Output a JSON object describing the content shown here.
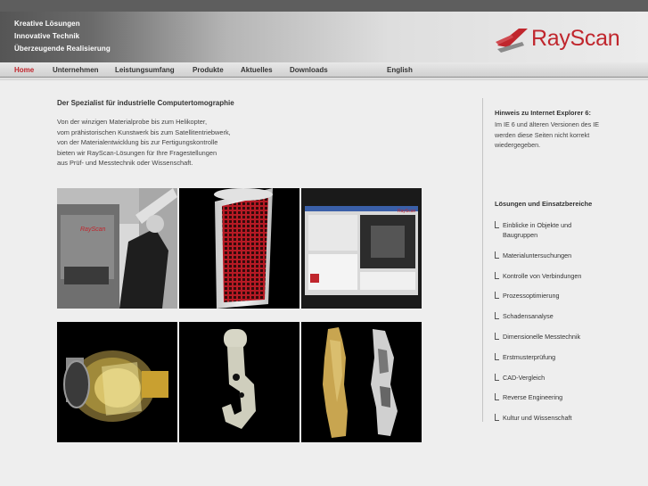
{
  "header": {
    "slogans": [
      "Kreative Lösungen",
      "Innovative Technik",
      "Überzeugende Realisierung"
    ],
    "logo_text": "RayScan",
    "brand_color": "#c0262d"
  },
  "nav": {
    "items": [
      "Home",
      "Unternehmen",
      "Leistungsumfang",
      "Produkte",
      "Aktuelles",
      "Downloads"
    ],
    "active": "Home",
    "language": "English"
  },
  "main": {
    "title": "Der Spezialist für industrielle Computertomographie",
    "intro_lines": [
      "Von der winzigen Materialprobe bis zum Helikopter,",
      "vom prähistorischen Kunstwerk bis zum Satellitentriebwerk,",
      "von der Materialentwicklung bis zur Fertigungskontrolle",
      "bieten wir RayScan-Lösungen für Ihre Fragestellungen",
      "aus Prüf- und Messtechnik oder Wissenschaft."
    ],
    "gallery": [
      {
        "icon": "rayscan-machine-photo",
        "label": "RayScan"
      },
      {
        "icon": "ct-mesh-cylinder-render"
      },
      {
        "icon": "software-screenshot",
        "label": "RayScan"
      },
      {
        "icon": "engine-ct-render"
      },
      {
        "icon": "hook-part-render"
      },
      {
        "icon": "figurine-ct-scan"
      }
    ]
  },
  "sidebar": {
    "notice_title": "Hinweis zu Internet Explorer 6:",
    "notice_lines": [
      "Im IE 6 und älteren Versionen des IE",
      "werden diese Seiten nicht korrekt",
      "wiedergegeben."
    ],
    "solutions_title": "Lösungen und Einsatzbereiche",
    "links": [
      [
        "Einblicke in Objekte und",
        "Baugruppen"
      ],
      [
        "Materialuntersuchungen"
      ],
      [
        "Kontrolle von Verbindungen"
      ],
      [
        "Prozessoptimierung"
      ],
      [
        "Schadensanalyse"
      ],
      [
        "Dimensionelle Messtechnik"
      ],
      [
        "Erstmusterprüfung"
      ],
      [
        "CAD-Vergleich"
      ],
      [
        "Reverse Engineering"
      ],
      [
        "Kultur und Wissenschaft"
      ]
    ]
  }
}
